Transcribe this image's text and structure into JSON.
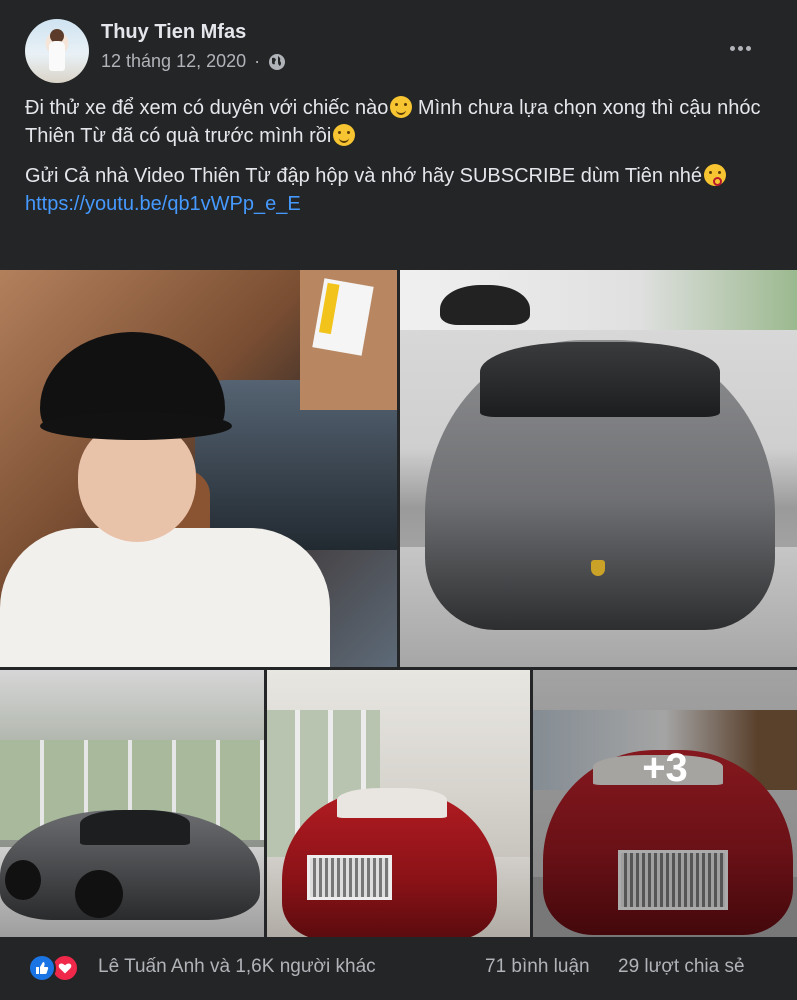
{
  "post": {
    "author": "Thuy Tien Mfas",
    "date": "12 tháng 12, 2020",
    "audience_icon": "globe-icon",
    "more_icon": "more-horizontal-icon",
    "line1_a": "Đi thử xe để xem có duyên với chiếc nào",
    "line1_b": " Mình chưa lựa chọn xong thì cậu nhóc Thiên Từ đã có quà trước mình rồi",
    "line2": "Gửi Cả nhà Video Thiên Từ đập hộp và nhớ hãy SUBSCRIBE dùm Tiên nhé",
    "link": "https://youtu.be/qb1vWPp_e_E"
  },
  "photos": {
    "extra_count": "+3"
  },
  "footer": {
    "reaction_icons": [
      "like-icon",
      "love-icon"
    ],
    "reaction_summary": "Lê Tuấn Anh và 1,6K người khác",
    "comments": "71 bình luận",
    "shares": "29 lượt chia sẻ"
  },
  "colors": {
    "background": "#242526",
    "text": "#e4e6eb",
    "secondary_text": "#b0b3b8",
    "link": "#4599ff",
    "like": "#1b74e4",
    "love": "#f0284a"
  }
}
